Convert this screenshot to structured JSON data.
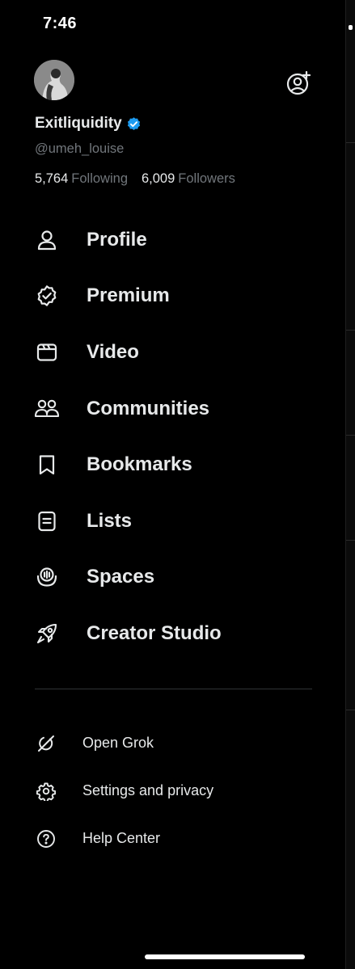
{
  "status_bar": {
    "time": "7:46"
  },
  "profile": {
    "display_name": "Exitliquidity",
    "handle": "@umeh_louise",
    "following_count": "5,764",
    "following_label": "Following",
    "followers_count": "6,009",
    "followers_label": "Followers",
    "verified": true
  },
  "menu": {
    "items": [
      {
        "label": "Profile",
        "icon": "person-icon"
      },
      {
        "label": "Premium",
        "icon": "premium-badge-icon"
      },
      {
        "label": "Video",
        "icon": "video-icon"
      },
      {
        "label": "Communities",
        "icon": "communities-icon"
      },
      {
        "label": "Bookmarks",
        "icon": "bookmark-icon"
      },
      {
        "label": "Lists",
        "icon": "list-icon"
      },
      {
        "label": "Spaces",
        "icon": "spaces-icon"
      },
      {
        "label": "Creator Studio",
        "icon": "rocket-icon"
      }
    ]
  },
  "secondary_menu": {
    "items": [
      {
        "label": "Open Grok",
        "icon": "grok-icon"
      },
      {
        "label": "Settings and privacy",
        "icon": "gear-icon"
      },
      {
        "label": "Help Center",
        "icon": "help-icon"
      }
    ]
  },
  "colors": {
    "background": "#000000",
    "text": "#e7e9ea",
    "muted": "#71767b",
    "verified": "#1d9bf0",
    "divider": "#2f3336"
  }
}
